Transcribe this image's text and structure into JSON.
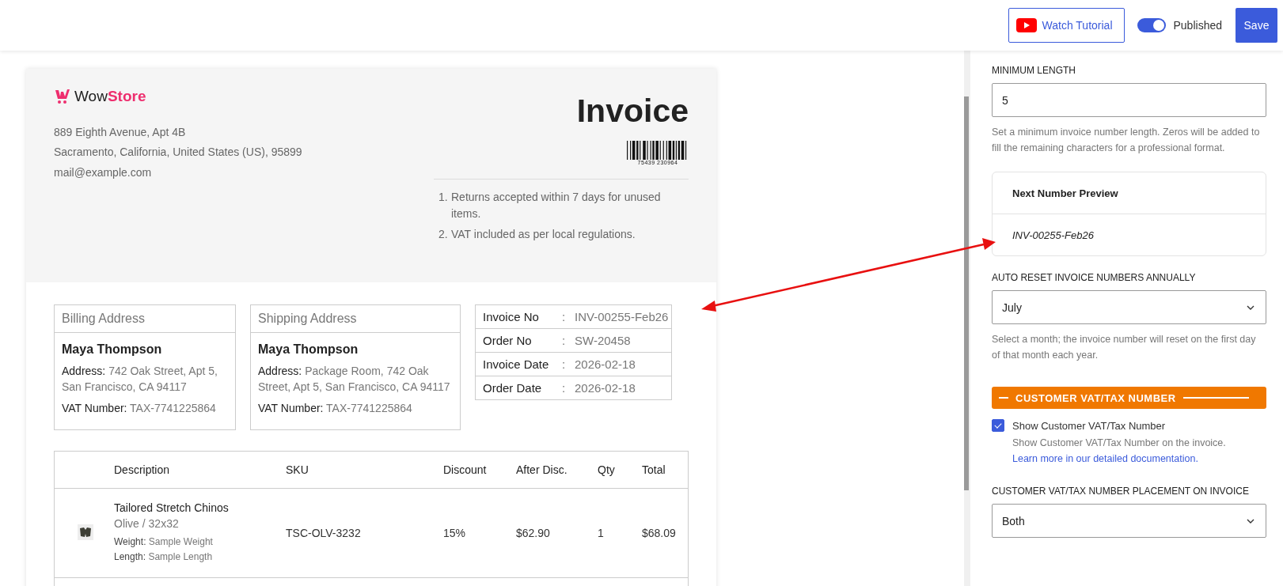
{
  "top_bar": {
    "watch_tutorial_button": "Watch Tutorial",
    "published_toggle": {
      "label": "Published",
      "on": true
    },
    "save_button": "Save"
  },
  "invoice": {
    "logo": {
      "text_1": "Wow",
      "text_2": "Store"
    },
    "store_address": [
      "889 Eighth Avenue, Apt 4B",
      "Sacramento, California, United States (US), 95899"
    ],
    "email": "mail@example.com",
    "title": "Invoice",
    "barcode_number": "75439 230964",
    "notes": [
      {
        "number": "1.",
        "text": "Returns accepted within 7 days for unused items."
      },
      {
        "number": "2.",
        "text": "VAT included as per local regulations."
      }
    ],
    "addresses": [
      {
        "heading": "Billing Address",
        "name": "Maya Thompson",
        "address_label": "Address:",
        "address": "742 Oak Street, Apt 5, San Francisco, CA 94117",
        "vat_label": "VAT Number:",
        "vat": "TAX-7741225864"
      },
      {
        "heading": "Shipping Address",
        "name": "Maya Thompson",
        "address_label": "Address:",
        "address": "Package Room, 742 Oak Street, Apt 5, San Francisco, CA 94117",
        "vat_label": "VAT Number:",
        "vat": "TAX-7741225864"
      }
    ],
    "info": [
      {
        "label": "Invoice No",
        "separator": ":",
        "value": "INV-00255-Feb26"
      },
      {
        "label": "Order No",
        "separator": ":",
        "value": "SW-20458"
      },
      {
        "label": "Invoice Date",
        "separator": ":",
        "value": "2026-02-18"
      },
      {
        "label": "Order Date",
        "separator": ":",
        "value": "2026-02-18"
      }
    ],
    "items_table": {
      "columns": [
        "Description",
        "SKU",
        "Discount",
        "After Disc.",
        "Qty",
        "Total"
      ],
      "rows": [
        {
          "name": "Tailored Stretch Chinos",
          "variant": "Olive / 32x32",
          "meta": [
            {
              "label": "Weight:",
              "value": "Sample Weight"
            },
            {
              "label": "Length:",
              "value": "Sample Length"
            }
          ],
          "sku": "TSC-OLV-3232",
          "discount": "15%",
          "after_discount": "$62.90",
          "qty": "1",
          "total": "$68.09"
        }
      ]
    }
  },
  "settings": [
    {
      "kind": "input",
      "label": "MINIMUM LENGTH",
      "value": "5",
      "help": "Set a minimum invoice number length. Zeros will be added to fill the remaining characters for a professional format."
    },
    {
      "kind": "preview",
      "title": "Next Number Preview",
      "value": "INV-00255-Feb26"
    },
    {
      "kind": "select",
      "label": "AUTO RESET INVOICE NUMBERS ANNUALLY",
      "value": "July",
      "help": "Select a month; the invoice number will reset on the first day of that month each year."
    },
    {
      "kind": "section",
      "title": "CUSTOMER VAT/TAX NUMBER"
    },
    {
      "kind": "checkbox",
      "label": "Show Customer VAT/Tax Number",
      "checked": true,
      "help": "Show Customer VAT/Tax Number on the invoice.",
      "link": "Learn more in our detailed documentation."
    },
    {
      "kind": "select",
      "label": "CUSTOMER VAT/TAX NUMBER PLACEMENT ON INVOICE",
      "value": "Both"
    }
  ]
}
